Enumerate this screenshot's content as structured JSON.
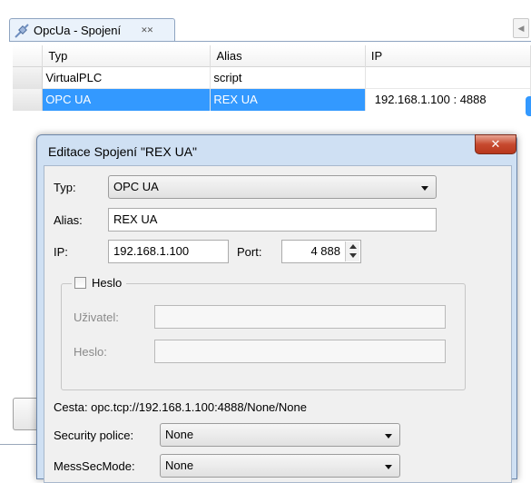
{
  "panel": {
    "tab_title": "OpcUa - Spojení",
    "tab_close_glyph": "✕✕",
    "scroll_glyph": "◀"
  },
  "table": {
    "headers": [
      "Typ",
      "Alias",
      "IP"
    ],
    "rows": [
      {
        "typ": "VirtualPLC",
        "alias": "script",
        "ip": ""
      },
      {
        "typ": "OPC UA",
        "alias": "REX UA",
        "ip": "192.168.1.100 : 4888",
        "selected": true
      }
    ]
  },
  "dialog": {
    "title": "Editace Spojení \"REX UA\"",
    "close_glyph": "✕",
    "typ_label": "Typ:",
    "typ_value": "OPC UA",
    "alias_label": "Alias:",
    "alias_value": "REX UA",
    "ip_label": "IP:",
    "ip_value": "192.168.1.100",
    "port_label": "Port:",
    "port_value": "4 888",
    "password_group": {
      "checkbox_label": "Heslo",
      "checked": false,
      "user_label": "Uživatel:",
      "user_value": "",
      "password_label": "Heslo:",
      "password_value": ""
    },
    "path_text": "Cesta: opc.tcp://192.168.1.100:4888/None/None",
    "security_label": "Security police:",
    "security_value": "None",
    "messsec_label": "MessSecMode:",
    "messsec_value": "None"
  },
  "colors": {
    "selection": "#3399ff",
    "dialog_frame": "#cfe0f3",
    "close_button": "#c74a2f"
  },
  "icons": [
    "connection-plug-icon",
    "tab-close-icon",
    "scroll-left-icon",
    "dropdown-arrow-icon",
    "spin-up-icon",
    "spin-down-icon",
    "window-close-icon"
  ]
}
